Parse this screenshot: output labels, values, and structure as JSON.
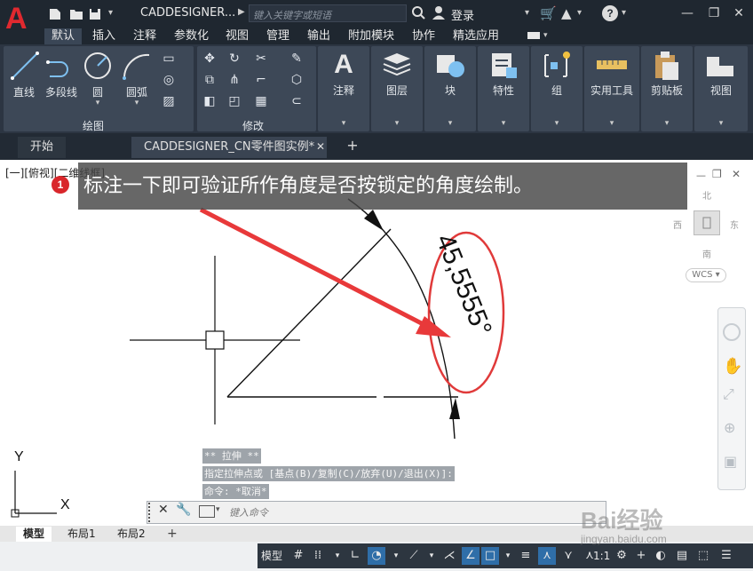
{
  "titlebar": {
    "app_title": "CADDESIGNER...",
    "search_placeholder": "键入关键字或短语",
    "login_label": "登录"
  },
  "menu_tabs": [
    "默认",
    "插入",
    "注释",
    "参数化",
    "视图",
    "管理",
    "输出",
    "附加模块",
    "协作",
    "精选应用"
  ],
  "ribbon": {
    "draw_tools": [
      "直线",
      "多段线",
      "圆",
      "圆弧"
    ],
    "draw_panel_label": "绘图",
    "modify_panel_label": "修改",
    "big_tools": [
      "注释",
      "图层",
      "块",
      "特性",
      "组",
      "实用工具",
      "剪贴板",
      "视图"
    ]
  },
  "file_tabs": {
    "start": "开始",
    "document": "CADDESIGNER_CN零件图实例*"
  },
  "canvas": {
    "view_label": "[一][俯视][二维线框]",
    "callout_number": "1",
    "callout_text": "标注一下即可验证所作角度是否按锁定的角度绘制。",
    "dimension_text": "45,5555°",
    "viewcube": {
      "north": "北",
      "south": "南",
      "east": "东",
      "west": "西",
      "wcs": "WCS"
    },
    "ucs_x": "X",
    "ucs_y": "Y"
  },
  "command": {
    "history": [
      "** 拉伸 **",
      "指定拉伸点或 [基点(B)/复制(C)/放弃(U)/退出(X)]:",
      "命令: *取消*"
    ],
    "input_placeholder": "键入命令"
  },
  "layout_tabs": [
    "模型",
    "布局1",
    "布局2"
  ],
  "statusbar": {
    "model_label": "模型",
    "scale_label": "1:1"
  },
  "watermark": {
    "brand": "Bai经验",
    "url": "jingyan.baidu.com"
  },
  "colors": {
    "accent_red": "#e0292f",
    "ribbon_bg": "#3d4857",
    "titlebar_bg": "#1f2730"
  }
}
